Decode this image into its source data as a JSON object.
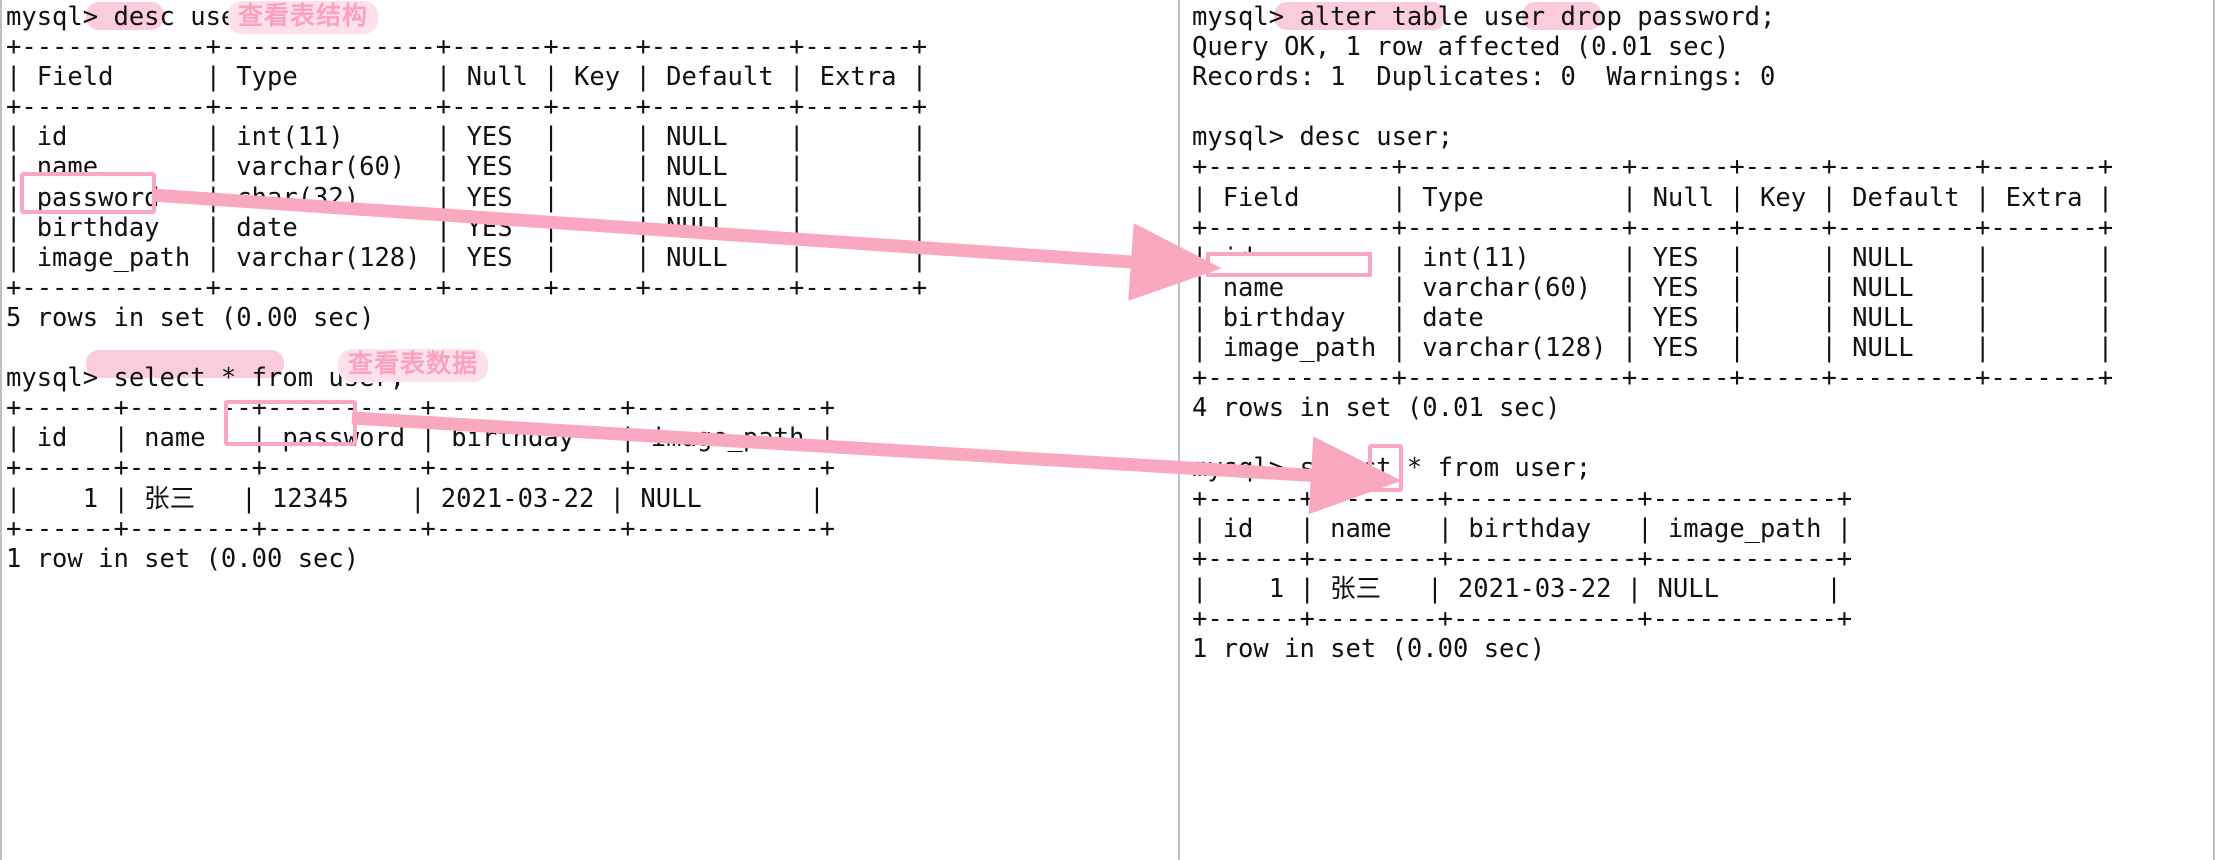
{
  "app": {
    "kind": "mysql-terminal-screenshot",
    "accent_pink": "#f9a8c0",
    "pill_pink": "#fbccda",
    "note_pink": "#f9a3be",
    "note_bg": "#fde0e9",
    "text_color": "#111111"
  },
  "left_panel": {
    "blocks": [
      {
        "prompt": "mysql> ",
        "command": "desc user;",
        "annotation": "查看表结构",
        "highlight_keywords": [
          "desc"
        ],
        "result_table": {
          "columns": [
            "Field",
            "Type",
            "Null",
            "Key",
            "Default",
            "Extra"
          ],
          "rows": [
            [
              "id",
              "int(11)",
              "YES",
              "",
              "NULL",
              ""
            ],
            [
              "name",
              "varchar(60)",
              "YES",
              "",
              "NULL",
              ""
            ],
            [
              "password",
              "char(32)",
              "YES",
              "",
              "NULL",
              ""
            ],
            [
              "birthday",
              "date",
              "YES",
              "",
              "NULL",
              ""
            ],
            [
              "image_path",
              "varchar(128)",
              "YES",
              "",
              "NULL",
              ""
            ]
          ],
          "footer": "5 rows in set (0.00 sec)"
        }
      },
      {
        "prompt": "mysql> ",
        "command": "select * from user;",
        "annotation": "查看表数据",
        "highlight_keywords": [
          "select * from"
        ],
        "result_table": {
          "columns": [
            "id",
            "name",
            "password",
            "birthday",
            "image_path"
          ],
          "rows": [
            [
              "1",
              "张三",
              "12345",
              "2021-03-22",
              "NULL"
            ]
          ],
          "footer": "1 row in set (0.00 sec)"
        }
      }
    ],
    "terminal_text": "mysql> desc user;\n+------------+--------------+------+-----+---------+-------+\n| Field      | Type         | Null | Key | Default | Extra |\n+------------+--------------+------+-----+---------+-------+\n| id         | int(11)      | YES  |     | NULL    |       |\n| name       | varchar(60)  | YES  |     | NULL    |       |\n| password   | char(32)     | YES  |     | NULL    |       |\n| birthday   | date         | YES  |     | NULL    |       |\n| image_path | varchar(128) | YES  |     | NULL    |       |\n+------------+--------------+------+-----+---------+-------+\n5 rows in set (0.00 sec)\n\nmysql> select * from user;\n+------+--------+----------+------------+------------+\n| id   | name   | password | birthday   | image_path |\n+------+--------+----------+------------+------------+\n|    1 | 张三   | 12345    | 2021-03-22 | NULL       |\n+------+--------+----------+------------+------------+\n1 row in set (0.00 sec)"
  },
  "right_panel": {
    "blocks": [
      {
        "prompt": "mysql> ",
        "command": "alter table user drop password;",
        "highlight_keywords": [
          "alter table",
          "drop"
        ],
        "status_lines": [
          "Query OK, 1 row affected (0.01 sec)",
          "Records: 1  Duplicates: 0  Warnings: 0"
        ]
      },
      {
        "prompt": "mysql> ",
        "command": "desc user;",
        "result_table": {
          "columns": [
            "Field",
            "Type",
            "Null",
            "Key",
            "Default",
            "Extra"
          ],
          "rows": [
            [
              "id",
              "int(11)",
              "YES",
              "",
              "NULL",
              ""
            ],
            [
              "name",
              "varchar(60)",
              "YES",
              "",
              "NULL",
              ""
            ],
            [
              "birthday",
              "date",
              "YES",
              "",
              "NULL",
              ""
            ],
            [
              "image_path",
              "varchar(128)",
              "YES",
              "",
              "NULL",
              ""
            ]
          ],
          "footer": "4 rows in set (0.01 sec)"
        }
      },
      {
        "prompt": "mysql> ",
        "command": "select * from user;",
        "result_table": {
          "columns": [
            "id",
            "name",
            "birthday",
            "image_path"
          ],
          "rows": [
            [
              "1",
              "张三",
              "2021-03-22",
              "NULL"
            ]
          ],
          "footer": "1 row in set (0.00 sec)"
        }
      }
    ],
    "terminal_text": "mysql> alter table user drop password;\nQuery OK, 1 row affected (0.01 sec)\nRecords: 1  Duplicates: 0  Warnings: 0\n\nmysql> desc user;\n+------------+--------------+------+-----+---------+-------+\n| Field      | Type         | Null | Key | Default | Extra |\n+------------+--------------+------+-----+---------+-------+\n| id         | int(11)      | YES  |     | NULL    |       |\n| name       | varchar(60)  | YES  |     | NULL    |       |\n| birthday   | date         | YES  |     | NULL    |       |\n| image_path | varchar(128) | YES  |     | NULL    |       |\n+------------+--------------+------+-----+---------+-------+\n4 rows in set (0.01 sec)\n\nmysql> select * from user;\n+------+--------+------------+------------+\n| id   | name   | birthday   | image_path |\n+------+--------+------------+------------+\n|    1 | 张三   | 2021-03-22 | NULL       |\n+------+--------+------------+------------+\n1 row in set (0.00 sec)"
  },
  "annotations": {
    "note_desc_label": "查看表结构",
    "note_select_label": "查看表数据",
    "arrow_count": 2,
    "box_count": 4
  }
}
